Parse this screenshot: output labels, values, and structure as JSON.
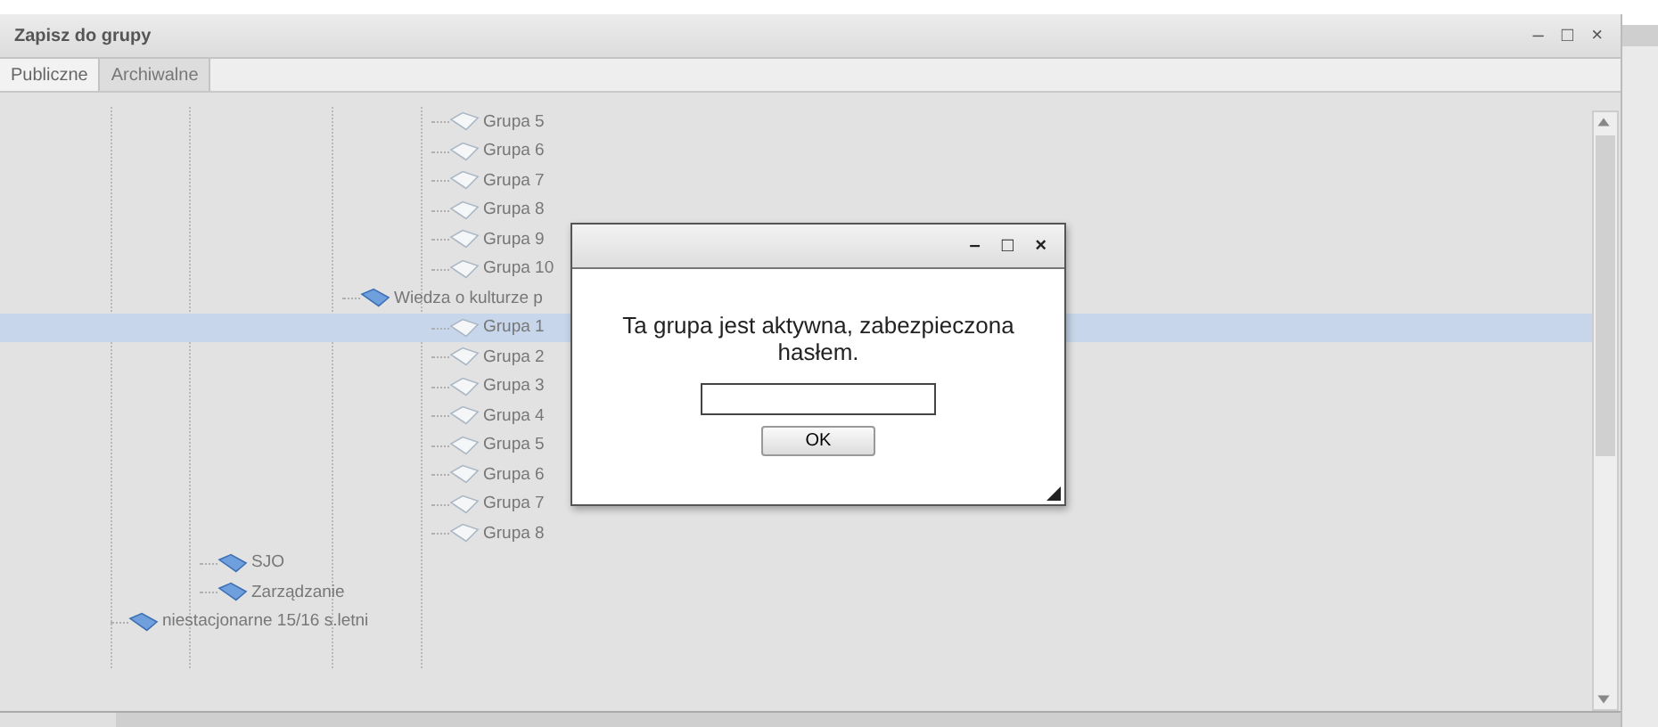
{
  "window": {
    "title": "Zapisz do grupy",
    "controls": [
      "–",
      "□",
      "×"
    ]
  },
  "tabs": [
    {
      "label": "Publiczne",
      "selected": true
    },
    {
      "label": "Archiwalne",
      "selected": false
    }
  ],
  "tree": [
    {
      "children": [
        {
          "children": [
            {
              "children": [
                {
                  "label": "Grupa 5",
                  "kind": "leaf",
                  "selected": false
                },
                {
                  "label": "Grupa 6",
                  "kind": "leaf",
                  "selected": false
                },
                {
                  "label": "Grupa 7",
                  "kind": "leaf",
                  "selected": false
                },
                {
                  "label": "Grupa 8",
                  "kind": "leaf",
                  "selected": false
                },
                {
                  "label": "Grupa 9",
                  "kind": "leaf",
                  "selected": false
                },
                {
                  "label": "Grupa 10",
                  "kind": "leaf",
                  "selected": false
                }
              ]
            },
            {
              "label": "Wiedza o kulturze p",
              "kind": "folder",
              "selected": false,
              "children": [
                {
                  "label": "Grupa 1",
                  "kind": "leaf",
                  "selected": true
                },
                {
                  "label": "Grupa 2",
                  "kind": "leaf",
                  "selected": false
                },
                {
                  "label": "Grupa 3",
                  "kind": "leaf",
                  "selected": false
                },
                {
                  "label": "Grupa 4",
                  "kind": "leaf",
                  "selected": false
                },
                {
                  "label": "Grupa 5",
                  "kind": "leaf",
                  "selected": false
                },
                {
                  "label": "Grupa 6",
                  "kind": "leaf",
                  "selected": false
                },
                {
                  "label": "Grupa 7",
                  "kind": "leaf",
                  "selected": false
                },
                {
                  "label": "Grupa 8",
                  "kind": "leaf",
                  "selected": false
                }
              ]
            }
          ]
        },
        {
          "label": "SJO",
          "kind": "folder",
          "selected": false
        },
        {
          "label": "Zarządzanie",
          "kind": "folder",
          "selected": false
        }
      ]
    },
    {
      "label": "niestacjonarne 15/16 s.letni",
      "kind": "folder",
      "selected": false
    }
  ],
  "dialog": {
    "controls": [
      "–",
      "□",
      "×"
    ],
    "message": "Ta grupa jest aktywna, zabezpieczona hasłem.",
    "button": "OK"
  }
}
